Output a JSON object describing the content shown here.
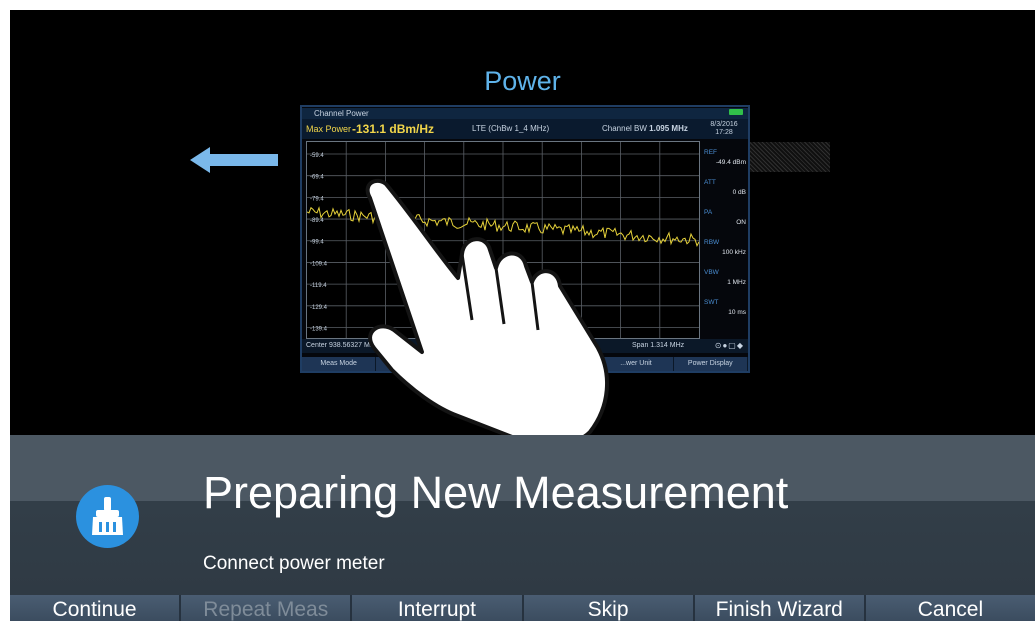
{
  "preview": {
    "title": "Power",
    "instrument": {
      "app_name": "Channel Power",
      "max_power_label": "Max Power",
      "max_power_value": "-131.1 dBm/Hz",
      "standard": "LTE (ChBw 1_4 MHz)",
      "channel_bw_label": "Channel BW",
      "channel_bw_value": "1.095 MHz",
      "date": "8/3/2016",
      "time": "17:28",
      "y_ticks": [
        "-59.4",
        "-69.4",
        "-79.4",
        "-89.4",
        "-99.4",
        "-109.4",
        "-119.4",
        "-129.4",
        "-139.4"
      ],
      "side": [
        {
          "key": "REF",
          "value": "-49.4 dBm"
        },
        {
          "key": "ATT",
          "value": "0 dB"
        },
        {
          "key": "PA",
          "value": "ON"
        },
        {
          "key": "RBW",
          "value": "100 kHz"
        },
        {
          "key": "VBW",
          "value": "1 MHz"
        },
        {
          "key": "SWT",
          "value": "10 ms"
        }
      ],
      "center_freq": "Center 938.56327 MHz",
      "span": "Span 1.314 MHz",
      "softkeys": [
        "Meas Mode",
        "St...",
        "",
        "",
        "...wer Unit",
        "Power Display"
      ],
      "trace_color": "#e6d23a"
    },
    "icons": {
      "arrow": "left-arrow-icon",
      "hand": "hand-pointer-icon",
      "battery": "battery-icon"
    }
  },
  "wizard": {
    "title": "Preparing New Measurement",
    "message": "Connect power meter",
    "icon": "brush-icon",
    "accent": "#2b91df"
  },
  "softkeys": [
    {
      "label": "Continue",
      "enabled": true
    },
    {
      "label": "Repeat Meas",
      "enabled": false
    },
    {
      "label": "Interrupt",
      "enabled": true
    },
    {
      "label": "Skip",
      "enabled": true
    },
    {
      "label": "Finish Wizard",
      "enabled": true
    },
    {
      "label": "Cancel",
      "enabled": true
    }
  ]
}
